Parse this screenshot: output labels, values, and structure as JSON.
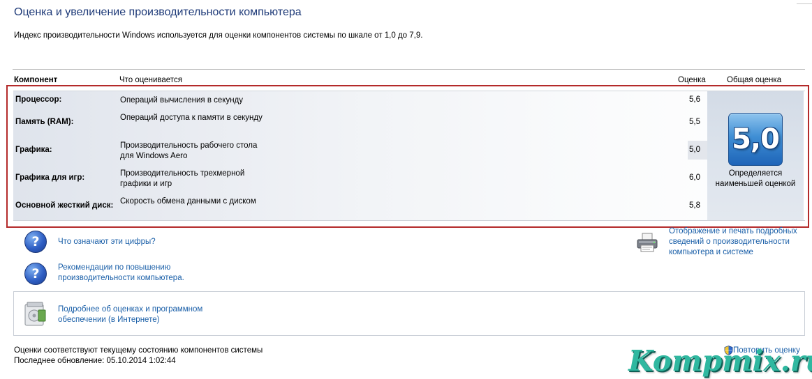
{
  "title": "Оценка и увеличение производительности компьютера",
  "intro": "Индекс производительности Windows используется для оценки компонентов системы по шкале от 1,0 до 7,9.",
  "table": {
    "headers": {
      "component": "Компонент",
      "what": "Что оценивается",
      "score": "Оценка",
      "total": "Общая оценка"
    },
    "rows": [
      {
        "component": "Процессор:",
        "what": "Операций вычисления в секунду",
        "score": "5,6"
      },
      {
        "component": "Память (RAM):",
        "what": "Операций доступа к памяти в секунду",
        "score": "5,5"
      },
      {
        "component": "Графика:",
        "what": "Производительность рабочего стола для Windows Aero",
        "score": "5,0"
      },
      {
        "component": "Графика для игр:",
        "what": "Производительность трехмерной графики и игр",
        "score": "6,0"
      },
      {
        "component": "Основной жесткий диск:",
        "what": "Скорость обмена данными с диском",
        "score": "5,8"
      }
    ],
    "total_score": "5,0",
    "total_note": "Определяется наименьшей оценкой"
  },
  "links": {
    "what_numbers_mean": "Что означают эти цифры?",
    "recommendations": "Рекомендации по повышению производительности компьютера.",
    "print_details": "Отображение и печать подробных сведений о производительности компьютера и системе",
    "more_info_online": "Подробнее об оценках и программном обеспечении (в Интернете)"
  },
  "footer": {
    "status": "Оценки соответствуют текущему состоянию компонентов системы",
    "last_update": "Последнее обновление: 05.10.2014 1:02:44",
    "recalc": "Повторить оценку"
  },
  "watermark": "Kompmix.ru",
  "icons": {
    "help": "help-question-icon",
    "printer": "printer-icon",
    "info": "software-info-icon",
    "shield": "uac-shield-icon"
  },
  "colors": {
    "title": "#1e3a78",
    "link": "#1a5fa8",
    "highlight_frame": "#b42a2a",
    "badge": "#3f8ed4",
    "watermark": "#2fb8a0"
  }
}
